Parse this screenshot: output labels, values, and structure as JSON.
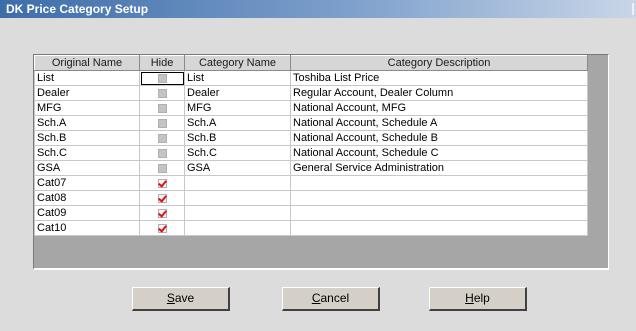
{
  "window": {
    "title": "DK Price Category Setup"
  },
  "grid": {
    "columns": [
      "Original Name",
      "Hide",
      "Category Name",
      "Category Description"
    ],
    "rows": [
      {
        "original": "List",
        "hide": false,
        "category": "List",
        "description": "Toshiba List Price"
      },
      {
        "original": "Dealer",
        "hide": false,
        "category": "Dealer",
        "description": "Regular Account, Dealer Column"
      },
      {
        "original": "MFG",
        "hide": false,
        "category": "MFG",
        "description": "National Account, MFG"
      },
      {
        "original": "Sch.A",
        "hide": false,
        "category": "Sch.A",
        "description": "National Account, Schedule A"
      },
      {
        "original": "Sch.B",
        "hide": false,
        "category": "Sch.B",
        "description": "National Account, Schedule B"
      },
      {
        "original": "Sch.C",
        "hide": false,
        "category": "Sch.C",
        "description": "National Account, Schedule C"
      },
      {
        "original": "GSA",
        "hide": false,
        "category": "GSA",
        "description": "General Service Administration"
      },
      {
        "original": "Cat07",
        "hide": true,
        "category": "",
        "description": ""
      },
      {
        "original": "Cat08",
        "hide": true,
        "category": "",
        "description": ""
      },
      {
        "original": "Cat09",
        "hide": true,
        "category": "",
        "description": ""
      },
      {
        "original": "Cat10",
        "hide": true,
        "category": "",
        "description": ""
      }
    ]
  },
  "buttons": {
    "save": {
      "accel": "S",
      "rest": "ave"
    },
    "cancel": {
      "accel": "C",
      "rest": "ancel"
    },
    "help": {
      "accel": "H",
      "rest": "elp"
    }
  },
  "colors": {
    "title_bar_start": "#3d6da8",
    "check_mark": "#e01010",
    "dialog_bg": "#dcdcdc"
  },
  "icons": {
    "checked": "red-checkmark-icon",
    "unchecked": "grey-checkbox-icon"
  }
}
